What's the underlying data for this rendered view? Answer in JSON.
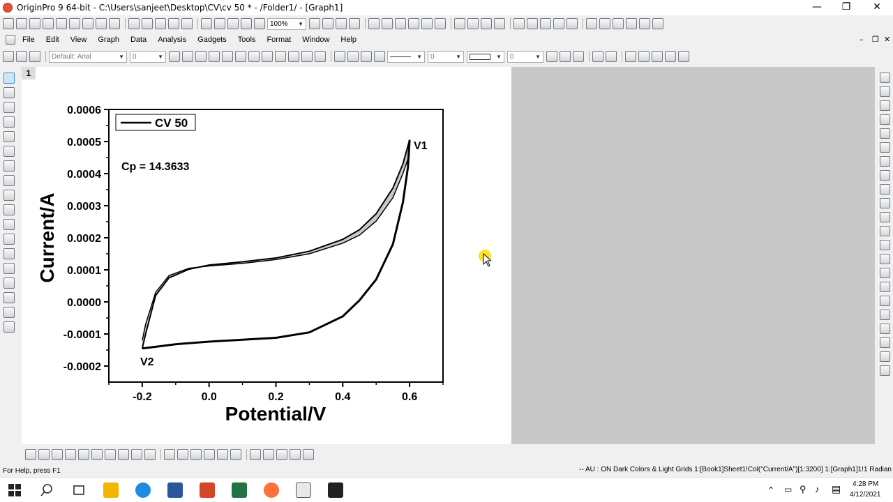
{
  "window": {
    "title": "OriginPro 9 64-bit - C:\\Users\\sanjeet\\Desktop\\CV\\cv 50 * - /Folder1/ - [Graph1]",
    "minimize": "—",
    "restore": "❐",
    "close": "✕"
  },
  "toolbar": {
    "zoom": "100%",
    "font_name": "Default: Arial",
    "font_size": "0",
    "line_width": "0",
    "border_width": "0"
  },
  "menu": {
    "items": [
      "File",
      "Edit",
      "View",
      "Graph",
      "Data",
      "Analysis",
      "Gadgets",
      "Tools",
      "Format",
      "Window",
      "Help"
    ]
  },
  "graph": {
    "layer_number": "1",
    "legend_label": "CV 50",
    "annotation_cp": "Cp = 14.3633",
    "label_v1": "V1",
    "label_v2": "V2",
    "fill_color": "#c8c8c8",
    "line_color": "#000000"
  },
  "chart_data": {
    "type": "line",
    "xlabel": "Potential/V",
    "ylabel": "Current/A",
    "xlim": [
      -0.3,
      0.7
    ],
    "ylim": [
      -0.00025,
      0.0006
    ],
    "xticks": [
      "-0.2",
      "0.0",
      "0.2",
      "0.4",
      "0.6"
    ],
    "xtick_values": [
      -0.2,
      0.0,
      0.2,
      0.4,
      0.6
    ],
    "yticks": [
      "0.0006",
      "0.0005",
      "0.0004",
      "0.0003",
      "0.0002",
      "0.0001",
      "0.0000",
      "-0.0001",
      "-0.0002"
    ],
    "ytick_values": [
      0.0006,
      0.0005,
      0.0004,
      0.0003,
      0.0002,
      0.0001,
      0.0,
      -0.0001,
      -0.0002
    ],
    "series": [
      {
        "name": "CV 50",
        "anodic_outer": [
          [
            -0.2,
            -0.000145
          ],
          [
            -0.19,
            -0.0001
          ],
          [
            -0.16,
            2e-05
          ],
          [
            -0.12,
            7.5e-05
          ],
          [
            -0.06,
            0.000102
          ],
          [
            0.0,
            0.000115
          ],
          [
            0.1,
            0.000125
          ],
          [
            0.2,
            0.000137
          ],
          [
            0.3,
            0.000158
          ],
          [
            0.4,
            0.000195
          ],
          [
            0.45,
            0.000225
          ],
          [
            0.5,
            0.000275
          ],
          [
            0.55,
            0.000355
          ],
          [
            0.58,
            0.00043
          ],
          [
            0.6,
            0.000505
          ]
        ],
        "anodic_inner": [
          [
            -0.2,
            -0.00012
          ],
          [
            -0.19,
            -7e-05
          ],
          [
            -0.16,
            3e-05
          ],
          [
            -0.12,
            8.2e-05
          ],
          [
            -0.06,
            0.000105
          ],
          [
            0.0,
            0.000112
          ],
          [
            0.1,
            0.00012
          ],
          [
            0.2,
            0.000132
          ],
          [
            0.3,
            0.00015
          ],
          [
            0.4,
            0.000183
          ],
          [
            0.45,
            0.000208
          ],
          [
            0.5,
            0.000252
          ],
          [
            0.55,
            0.000325
          ],
          [
            0.58,
            0.0004
          ],
          [
            0.6,
            0.00046
          ]
        ],
        "cathodic": [
          [
            0.6,
            0.000505
          ],
          [
            0.595,
            0.00042
          ],
          [
            0.58,
            0.00031
          ],
          [
            0.55,
            0.00018
          ],
          [
            0.5,
            7e-05
          ],
          [
            0.45,
            5e-06
          ],
          [
            0.4,
            -4.5e-05
          ],
          [
            0.3,
            -9.5e-05
          ],
          [
            0.2,
            -0.000112
          ],
          [
            0.1,
            -0.000118
          ],
          [
            0.0,
            -0.000124
          ],
          [
            -0.1,
            -0.000132
          ],
          [
            -0.16,
            -0.00014
          ],
          [
            -0.2,
            -0.000145
          ]
        ]
      }
    ]
  },
  "statusbar": {
    "help": "For Help, press F1",
    "info": "-- AU : ON  Dark Colors & Light Grids  1:[Book1]Sheet1!Col(\"Current/A\")[1:3200]  1:[Graph1]1!1  Radian"
  },
  "taskbar": {
    "time": "4:28 PM",
    "date": "4/12/2021"
  }
}
